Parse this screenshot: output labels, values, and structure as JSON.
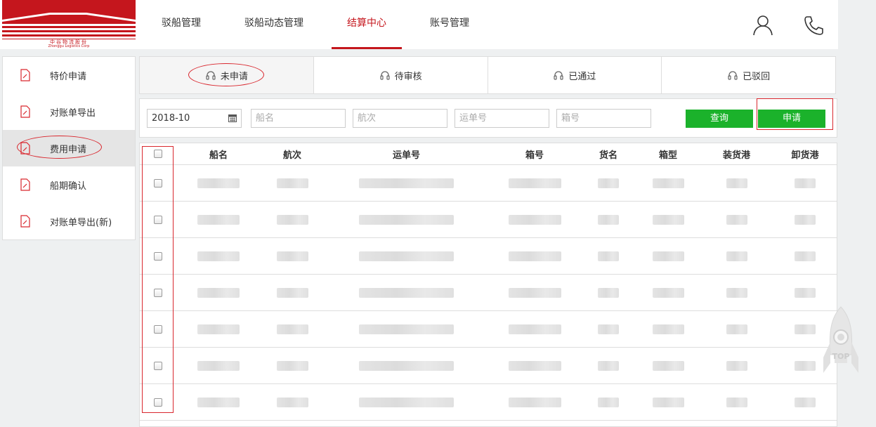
{
  "logo": {
    "line1": "中谷物流股份",
    "line2": "Zhonggu Logistics Corp"
  },
  "nav": [
    {
      "label": "驳船管理",
      "active": false
    },
    {
      "label": "驳船动态管理",
      "active": false
    },
    {
      "label": "结算中心",
      "active": true
    },
    {
      "label": "账号管理",
      "active": false
    }
  ],
  "header_icons": [
    "user-icon",
    "phone-icon"
  ],
  "sidebar": [
    {
      "label": "特价申请",
      "active": false
    },
    {
      "label": "对账单导出",
      "active": false
    },
    {
      "label": "费用申请",
      "active": true
    },
    {
      "label": "船期确认",
      "active": false
    },
    {
      "label": "对账单导出(新)",
      "active": false
    }
  ],
  "tabs": [
    {
      "label": "未申请",
      "active": true
    },
    {
      "label": "待审核",
      "active": false
    },
    {
      "label": "已通过",
      "active": false
    },
    {
      "label": "已驳回",
      "active": false
    }
  ],
  "filter": {
    "date_value": "2018-10",
    "ship_placeholder": "船名",
    "voyage_placeholder": "航次",
    "waybill_placeholder": "运单号",
    "box_placeholder": "箱号",
    "query_label": "查询",
    "apply_label": "申请"
  },
  "table": {
    "headers": [
      "船名",
      "航次",
      "运单号",
      "箱号",
      "货名",
      "箱型",
      "装货港",
      "卸货港"
    ],
    "row_count": 7
  },
  "rocket": {
    "label": "TOP"
  },
  "colors": {
    "brand": "#c5161d",
    "button": "#1bb22b",
    "annotation": "#d9272e"
  }
}
